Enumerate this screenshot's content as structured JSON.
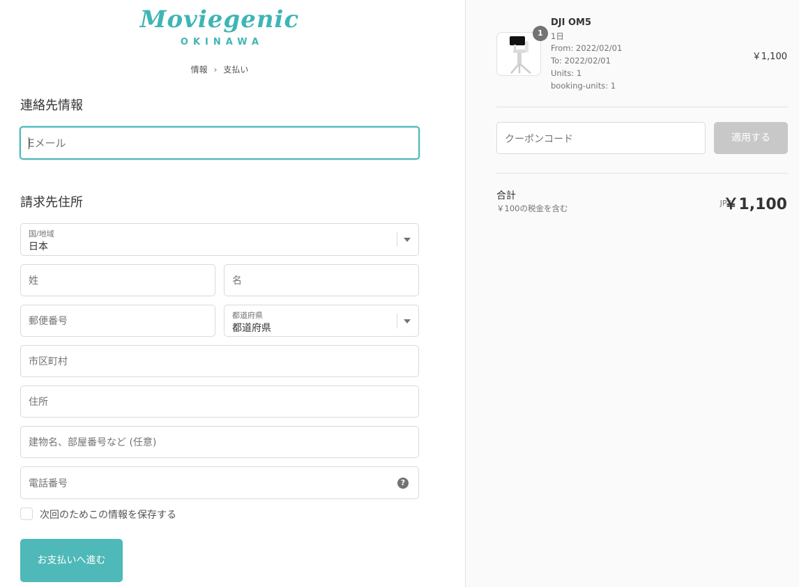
{
  "brand": {
    "name": "Moviegenic",
    "location": "OKINAWA",
    "color": "#4fb8b8"
  },
  "breadcrumb": {
    "step1": "情報",
    "step2": "支払い"
  },
  "contact": {
    "title": "連絡先情報",
    "email_placeholder": "Eメール"
  },
  "billing": {
    "title": "請求先住所",
    "country_label": "国/地域",
    "country_value": "日本",
    "last_name_placeholder": "姓",
    "first_name_placeholder": "名",
    "postal_placeholder": "郵便番号",
    "prefecture_label": "都道府県",
    "prefecture_value": "都道府県",
    "city_placeholder": "市区町村",
    "address_placeholder": "住所",
    "building_placeholder": "建物名、部屋番号など (任意)",
    "phone_placeholder": "電話番号"
  },
  "save_info_label": "次回のためこの情報を保存する",
  "continue_button": "お支払いへ進む",
  "cart": {
    "item": {
      "quantity": "1",
      "name": "DJI OM5",
      "duration": "1日",
      "from": "From: 2022/02/01",
      "to": "To: 2022/02/01",
      "units": "Units: 1",
      "booking_units": "booking-units: 1",
      "price": "￥1,100"
    },
    "coupon_placeholder": "クーポンコード",
    "apply_button": "適用する",
    "total_label": "合計",
    "tax_note": "￥100の税金を含む",
    "currency": "JPY",
    "total_value": "￥1,100"
  }
}
